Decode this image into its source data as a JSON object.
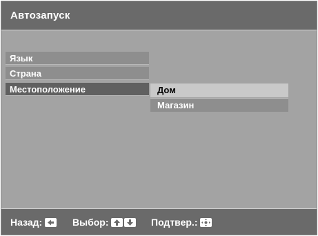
{
  "title": "Автозапуск",
  "menu": {
    "items": [
      {
        "label": "Язык"
      },
      {
        "label": "Страна"
      },
      {
        "label": "Местоположение"
      }
    ],
    "selected": "Местоположение"
  },
  "submenu": {
    "items": [
      {
        "label": "Дом"
      },
      {
        "label": "Магазин"
      }
    ],
    "highlighted": "Дом"
  },
  "footer": {
    "back_label": "Назад:",
    "back_icon": "left-arrow-icon",
    "select_label": "Выбор:",
    "select_icons": [
      "up-arrow-icon",
      "down-arrow-icon"
    ],
    "confirm_label": "Подтвер.:",
    "confirm_icon": "dpad-center-icon"
  },
  "colors": {
    "bar": "#6a6a6a",
    "panel": "#a3a3a3",
    "item": "#8e8e8e",
    "selected_item": "#606060",
    "highlight": "#c9c9c9"
  }
}
